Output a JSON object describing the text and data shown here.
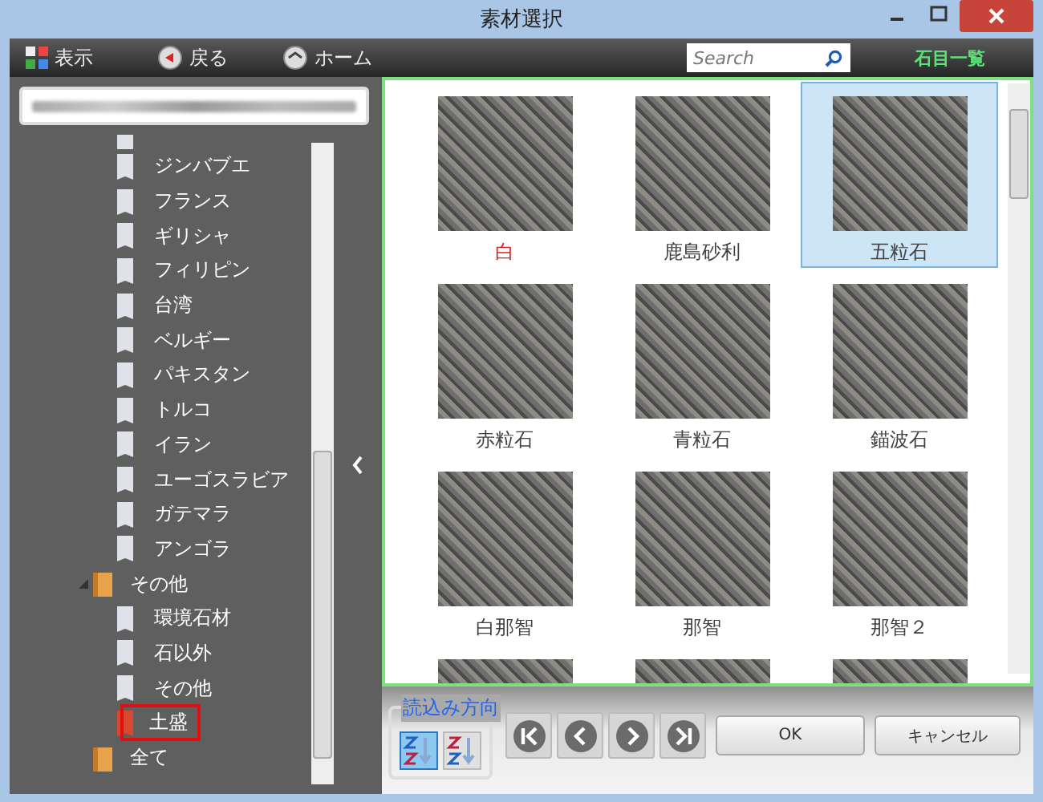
{
  "window": {
    "title": "素材選択"
  },
  "toolbar": {
    "view_button": "表示",
    "back_button": "戻る",
    "home_button": "ホーム",
    "search": {
      "placeholder": "Search"
    },
    "mode_label": "石目一覧"
  },
  "tree": {
    "continued_children": [
      {
        "label": "ジンバブエ",
        "selected": false
      },
      {
        "label": "フランス",
        "selected": false
      },
      {
        "label": "ギリシャ",
        "selected": false
      },
      {
        "label": "フィリピン",
        "selected": false
      },
      {
        "label": "台湾",
        "selected": false
      },
      {
        "label": "ベルギー",
        "selected": false
      },
      {
        "label": "パキスタン",
        "selected": false
      },
      {
        "label": "トルコ",
        "selected": false
      },
      {
        "label": "イラン",
        "selected": false
      },
      {
        "label": "ユーゴスラビア",
        "selected": false
      },
      {
        "label": "ガテマラ",
        "selected": false
      },
      {
        "label": "アンゴラ",
        "selected": false
      }
    ],
    "nodes": [
      {
        "label": "その他",
        "selected": false,
        "expanded": true,
        "children": [
          {
            "label": "環境石材",
            "selected": false
          },
          {
            "label": "石以外",
            "selected": false
          },
          {
            "label": "その他",
            "selected": false
          },
          {
            "label": "土盛",
            "selected": true
          }
        ]
      },
      {
        "label": "全て",
        "selected": false,
        "expanded": false
      }
    ]
  },
  "grid": {
    "items": [
      {
        "label": "白",
        "selected": false,
        "color": "#e02020"
      },
      {
        "label": "鹿島砂利",
        "selected": false,
        "color": "#404040"
      },
      {
        "label": "五粒石",
        "selected": true,
        "color": "#404040"
      },
      {
        "label": "赤粒石",
        "selected": false,
        "color": "#404040"
      },
      {
        "label": "青粒石",
        "selected": false,
        "color": "#404040"
      },
      {
        "label": "錨波石",
        "selected": false,
        "color": "#404040"
      },
      {
        "label": "白那智",
        "selected": false,
        "color": "#404040"
      },
      {
        "label": "那智",
        "selected": false,
        "color": "#404040"
      },
      {
        "label": "那智２",
        "selected": false,
        "color": "#404040"
      },
      {
        "selected": false
      },
      {
        "selected": false
      },
      {
        "selected": false
      }
    ]
  },
  "bottom": {
    "direction_group": {
      "title": "読込み方向",
      "options": [
        {
          "kind": "ascending",
          "selected": true
        },
        {
          "kind": "descending",
          "selected": false
        }
      ]
    },
    "ok_button": "OK",
    "cancel_button": "キャンセル"
  }
}
